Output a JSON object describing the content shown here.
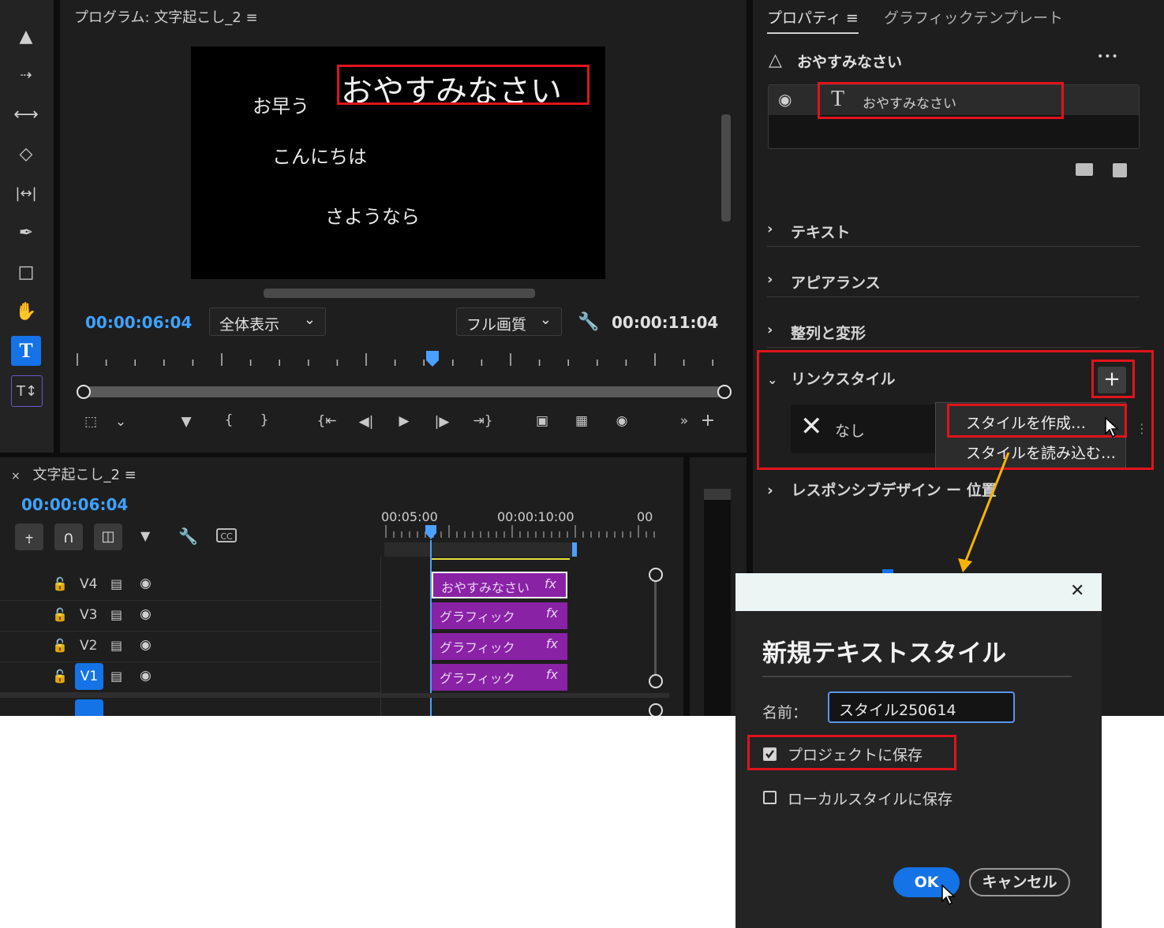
{
  "program_monitor": {
    "title": "プログラム: 文字起こし_2",
    "menu_glyph": "≡",
    "preview_texts": [
      "お早う",
      "おやすみなさい",
      "こんにちは",
      "さようなら"
    ],
    "current_time": "00:00:06:04",
    "zoom_select": "全体表示",
    "quality_select": "フル画質",
    "duration": "00:00:11:04"
  },
  "timeline": {
    "title": "文字起こし_2",
    "close_glyph": "×",
    "current_time": "00:00:06:04",
    "ruler_labels": [
      "00:05:00",
      "00:00:10:00",
      "00"
    ],
    "tracks": [
      {
        "name": "V4",
        "clip": "おやすみなさい",
        "fx": "fx"
      },
      {
        "name": "V3",
        "clip": "グラフィック",
        "fx": "fx"
      },
      {
        "name": "V2",
        "clip": "グラフィック",
        "fx": "fx"
      },
      {
        "name": "V1",
        "clip": "グラフィック",
        "fx": "fx"
      }
    ]
  },
  "properties": {
    "tab_active": "プロパティ",
    "tab_inactive": "グラフィックテンプレート",
    "selected_name": "おやすみなさい",
    "more_glyph": "•••",
    "layer_name": "おやすみなさい",
    "sections": [
      "テキスト",
      "アピアランス",
      "整列と変形"
    ],
    "linked_style_label": "リンクスタイル",
    "style_value": "なし",
    "menu_items": [
      "スタイルを作成…",
      "スタイルを読み込む…"
    ],
    "responsive_label": "レスポンシブデザイン ー 位置"
  },
  "dialog": {
    "title": "新規テキストスタイル",
    "name_label": "名前：",
    "name_value": "スタイル250614",
    "save_project_label": "プロジェクトに保存",
    "save_project_checked": true,
    "save_local_label": "ローカルスタイルに保存",
    "save_local_checked": false,
    "ok_label": "OK",
    "cancel_label": "キャンセル"
  },
  "colors": {
    "accent_blue": "#1473e6",
    "highlight_red": "#e0141c",
    "clip_purple": "#8a22a6",
    "arrow_orange": "#f5b400"
  }
}
